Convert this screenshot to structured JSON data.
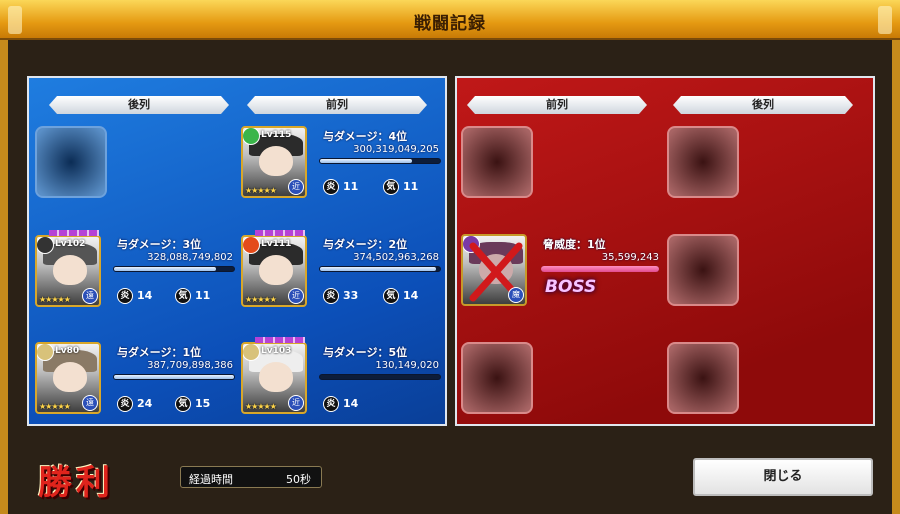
{
  "window": {
    "title": "戦闘記録"
  },
  "ally": {
    "back_row_label": "後列",
    "front_row_label": "前列",
    "units": [
      {
        "level": "Lv115",
        "damage_rank": "与ダメージ：4位",
        "damage": "300,319,049,205",
        "bar_fraction": 0.77,
        "stat1_icon": "炎",
        "stat1": "11",
        "stat2_icon": "気",
        "stat2": "11",
        "role": "近",
        "element": "wind"
      },
      {
        "level": "Lv102",
        "damage_rank": "与ダメージ：3位",
        "damage": "328,088,749,802",
        "bar_fraction": 0.85,
        "stat1_icon": "炎",
        "stat1": "14",
        "stat2_icon": "気",
        "stat2": "11",
        "role": "遠",
        "element": "dark"
      },
      {
        "level": "Lv111",
        "damage_rank": "与ダメージ：2位",
        "damage": "374,502,963,268",
        "bar_fraction": 0.97,
        "stat1_icon": "炎",
        "stat1": "33",
        "stat2_icon": "気",
        "stat2": "14",
        "role": "近",
        "element": "fire"
      },
      {
        "level": "Lv80",
        "damage_rank": "与ダメージ：1位",
        "damage": "387,709,898,386",
        "bar_fraction": 1.0,
        "stat1_icon": "炎",
        "stat1": "24",
        "stat2_icon": "気",
        "stat2": "15",
        "role": "遠",
        "element": "light"
      },
      {
        "level": "Lv103",
        "damage_rank": "与ダメージ：5位",
        "damage": "130,149,020",
        "bar_fraction": 0.0,
        "stat1_icon": "炎",
        "stat1": "14",
        "role": "近",
        "element": "light"
      }
    ]
  },
  "enemy": {
    "front_row_label": "前列",
    "back_row_label": "後列",
    "boss": {
      "threat_rank": "脅威度：1位",
      "threat": "35,599,243",
      "bar_fraction": 1.0,
      "badge": "BOSS",
      "role": "魔"
    }
  },
  "footer": {
    "result": "勝利",
    "elapsed_label": "経過時間",
    "elapsed_value": "50秒",
    "close_label": "閉じる"
  },
  "colors": {
    "ally_panel": "#1468d2",
    "enemy_panel": "#a80f0f",
    "title_bar": "#f1b52a",
    "boss_bar": "#e14b8e"
  }
}
